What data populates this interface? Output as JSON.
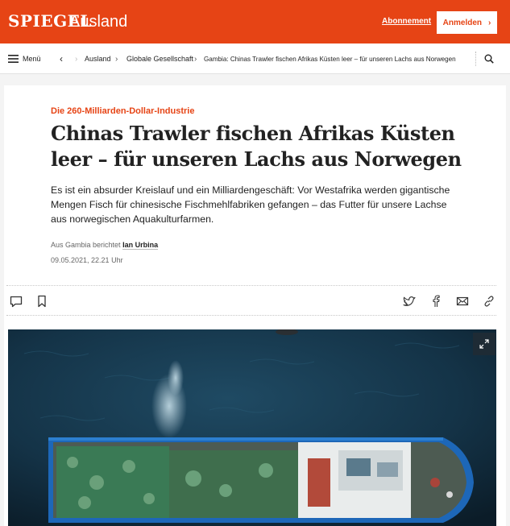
{
  "header": {
    "logo": "SPIEGEL",
    "section": "Ausland",
    "subscription_link": "Abonnement",
    "login_button": "Anmelden",
    "login_chevron": "›",
    "accent_color": "#e64415"
  },
  "navbar": {
    "menu_label": "Menü",
    "back_glyph": "‹",
    "breadcrumb": [
      "Ausland",
      "Globale Gesellschaft",
      "Gambia: Chinas Trawler fischen Afrikas Küsten leer – für unseren Lachs aus Norwegen"
    ],
    "separator": "›"
  },
  "article": {
    "kicker": "Die 260-Milliarden-Dollar-Industrie",
    "headline": "Chinas Trawler fischen Afrikas Küsten leer – für unseren Lachs aus Norwegen",
    "lead": "Es ist ein absurder Kreislauf und ein Milliardengeschäft: Vor Westafrika werden gigantische Mengen Fisch für chinesische Fischmehlfabriken gefangen – das Futter für unsere Lachse aus norwegischen Aquakulturfarmen.",
    "byline_prefix": "Aus Gambia berichtet",
    "author": "Ian Urbina",
    "date": "09.05.2021, 22.21 Uhr"
  },
  "icons": {
    "menu": "hamburger-icon",
    "search": "search-icon",
    "comment": "comment-icon",
    "bookmark": "bookmark-icon",
    "twitter": "twitter-icon",
    "facebook": "facebook-icon",
    "mail": "mail-icon",
    "link": "link-icon",
    "expand": "expand-icon"
  }
}
